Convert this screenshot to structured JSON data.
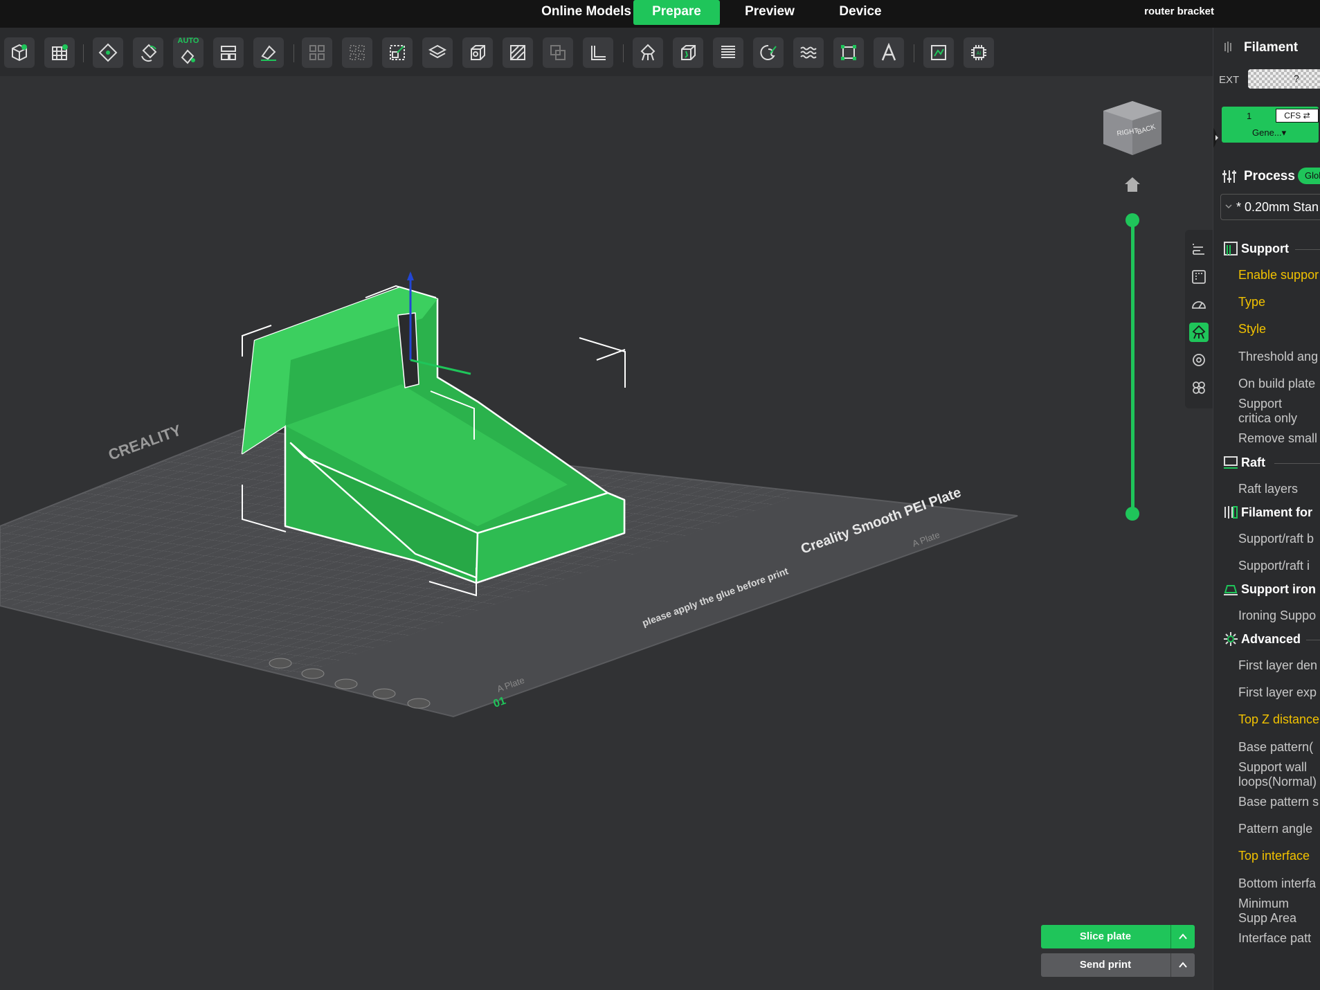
{
  "tabs": [
    {
      "label": "Online Models",
      "active": false
    },
    {
      "label": "Prepare",
      "active": true
    },
    {
      "label": "Preview",
      "active": false
    },
    {
      "label": "Device",
      "active": false
    }
  ],
  "document_title": "router bracket",
  "toolbar": {
    "auto_badge": "AUTO",
    "items": [
      "add-object-icon",
      "add-plate-icon",
      "arrange-icon",
      "auto-orient-icon",
      "auto-orient-all-icon",
      "lay-on-face-icon",
      "place-icon",
      "grid-align-icon",
      "distribute-icon",
      "scale-icon",
      "layer-icon",
      "box-icon",
      "cut-icon",
      "boolean-icon",
      "measure-icon",
      "support-paint-icon",
      "seam-paint-icon",
      "variable-layer-icon",
      "paint-icon",
      "fuzzy-skin-icon",
      "assembly-icon",
      "text-icon",
      "svg-icon",
      "ai-icon"
    ]
  },
  "viewport": {
    "view_cube": {
      "right": "RIGHT",
      "back": "BACK"
    },
    "plate_text_1": "Creality Smooth PEI Plate",
    "plate_text_2": "please apply the glue before print",
    "plate_brand": "CREALITY",
    "plate_side_1": "A Plate",
    "plate_side_2": "A Plate",
    "plate_number": "01"
  },
  "actions": {
    "slice_label": "Slice plate",
    "send_label": "Send print"
  },
  "right_panel": {
    "filament_title": "Filament",
    "ext_label": "EXT",
    "ext_value": "?",
    "slot_number": "1",
    "slot_cfs": "CFS ⇄",
    "slot_name": "Gene...▾",
    "process_title": "Process",
    "process_badge": "Glol",
    "preset": "* 0.20mm Stan",
    "sections": [
      {
        "title": "Support",
        "items": [
          {
            "label": "Enable suppor",
            "modified": true
          },
          {
            "label": "Type",
            "modified": true
          },
          {
            "label": "Style",
            "modified": true
          },
          {
            "label": "Threshold ang",
            "modified": false
          },
          {
            "label": "On build plate",
            "modified": false
          },
          {
            "label": "Support critica only",
            "modified": false
          },
          {
            "label": "Remove small",
            "modified": false
          }
        ]
      },
      {
        "title": "Raft",
        "items": [
          {
            "label": "Raft layers",
            "modified": false
          }
        ]
      },
      {
        "title": "Filament for",
        "items": [
          {
            "label": "Support/raft b",
            "modified": false
          },
          {
            "label": "Support/raft i",
            "modified": false
          }
        ]
      },
      {
        "title": "Support iron",
        "items": [
          {
            "label": "Ironing Suppo",
            "modified": false
          }
        ]
      },
      {
        "title": "Advanced",
        "items": [
          {
            "label": "First layer den",
            "modified": false
          },
          {
            "label": "First layer exp",
            "modified": false
          },
          {
            "label": "Top Z distance",
            "modified": true
          },
          {
            "label": "Base pattern(",
            "modified": false
          },
          {
            "label": "Support wall loops(Normal)",
            "modified": false
          },
          {
            "label": "Base pattern s",
            "modified": false
          },
          {
            "label": "Pattern angle",
            "modified": false
          },
          {
            "label": "Top interface",
            "modified": true
          },
          {
            "label": "Bottom interfa",
            "modified": false
          },
          {
            "label": "Minimum Supp Area",
            "modified": false
          },
          {
            "label": "Interface patt",
            "modified": false
          }
        ]
      }
    ]
  },
  "colors": {
    "accent": "#1fc55a",
    "modified": "#f2c200",
    "background": "#313234"
  }
}
